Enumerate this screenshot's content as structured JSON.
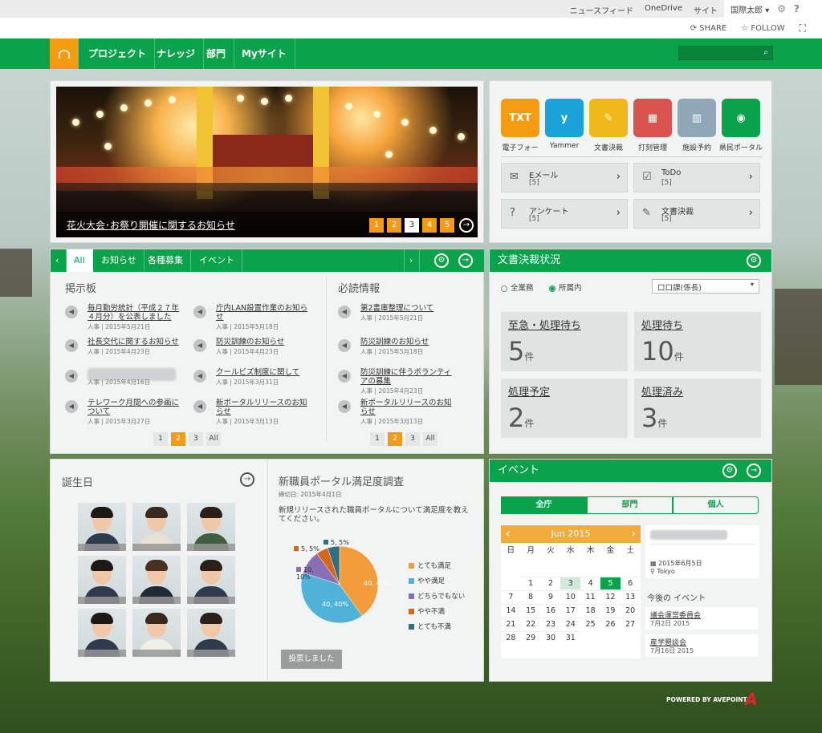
{
  "suite": {
    "links": [
      "ニュースフィード",
      "OneDrive",
      "サイト"
    ],
    "user": "国際太郎",
    "user_caret": "▾",
    "gear": "⚙",
    "help": "?"
  },
  "actions": {
    "share": "SHARE",
    "follow": "FOLLOW"
  },
  "nav": {
    "items": [
      "プロジェクト",
      "ナレッジ",
      "部門",
      "Myサイト"
    ],
    "search_icon": "⌕"
  },
  "hero": {
    "caption": "花火大会･お祭り開催に関するお知らせ",
    "pages": [
      "1",
      "2",
      "3",
      "4",
      "5"
    ],
    "current_page": "3",
    "next_icon": "→"
  },
  "apps": {
    "tiles": [
      {
        "label": "電子フォー",
        "glyph": "TXT",
        "color": "#f39c12"
      },
      {
        "label": "Yammer",
        "glyph": "y",
        "color": "#1aa3d9"
      },
      {
        "label": "文書決裁",
        "glyph": "✎",
        "color": "#f1b81c"
      },
      {
        "label": "打刻管理",
        "glyph": "▦",
        "color": "#d9534f"
      },
      {
        "label": "施設予約",
        "glyph": "▥",
        "color": "#8fa8b8"
      },
      {
        "label": "県民ポータル",
        "glyph": "◉",
        "color": "#0aa24b"
      }
    ],
    "quick": [
      {
        "title": "Eメール",
        "count": "[5]",
        "icon": "✉",
        "arrow": "›"
      },
      {
        "title": "ToDo",
        "count": "[5]",
        "icon": "☑",
        "arrow": "›"
      },
      {
        "title": "アンケート",
        "count": "[5]",
        "icon": "?",
        "arrow": "›"
      },
      {
        "title": "文書決裁",
        "count": "[5]",
        "icon": "✎",
        "arrow": "›"
      }
    ]
  },
  "news": {
    "prev": "‹",
    "next": "›",
    "tabs": [
      "All",
      "お知らせ",
      "各種募集",
      "イベント"
    ],
    "board_title": "掲示板",
    "board": [
      {
        "title": "毎月勤労統計（平成２７年４月分）を公表しました",
        "meta": "人事 | 2015年5月21日"
      },
      {
        "title": "庁内LAN設置作業のお知らせ",
        "meta": "人事 | 2015年5月18日"
      },
      {
        "title": "社長交代に関するお知らせ",
        "meta": "人事 | 2015年4月23日"
      },
      {
        "title": "防災訓練のお知らせ",
        "meta": "人事 | 2015年4月23日"
      },
      {
        "title": "",
        "meta": "人事 | 2015年4月16日"
      },
      {
        "title": "クールビズ制度に関して",
        "meta": "人事 | 2015年3月31日"
      },
      {
        "title": "テレワーク月間への参画について",
        "meta": "人事 | 2015年3月27日"
      },
      {
        "title": "新ポータルリリースのお知らせ",
        "meta": "人事 | 2015年3月13日"
      }
    ],
    "board_pages": [
      "1",
      "2",
      "3",
      "All"
    ],
    "required_title": "必読情報",
    "required": [
      {
        "title": "第2書庫整理について",
        "meta": "人事 | 2015年5月21日"
      },
      {
        "title": "防災訓練のお知らせ",
        "meta": "人事 | 2015年5月18日"
      },
      {
        "title": "防災訓練に伴うボランティアの募集",
        "meta": "人事 | 2015年4月23日"
      },
      {
        "title": "新ポータルリリースのお知らせ",
        "meta": "人事 | 2015年3月13日"
      }
    ],
    "required_pages": [
      "1",
      "2",
      "3",
      "All"
    ]
  },
  "docstatus": {
    "title": "文書決裁状況",
    "radio_all": "全業務",
    "radio_dept": "所属内",
    "select": "口口課(係長)",
    "stats": [
      {
        "label": "至急・処理待ち",
        "value": "5",
        "unit": "件"
      },
      {
        "label": "処理待ち",
        "value": "10",
        "unit": "件"
      },
      {
        "label": "処理予定",
        "value": "2",
        "unit": "件"
      },
      {
        "label": "処理済み",
        "value": "3",
        "unit": "件"
      }
    ]
  },
  "birthday": {
    "title": "誕生日"
  },
  "survey": {
    "title": "新職員ポータル満足度調査",
    "deadline": "締切日: 2015年4月1日",
    "question": "新規リリースされた職員ポータルについて満足度を教えてください。",
    "button": "投票しました",
    "slice_labels": [
      "40, 40%",
      "40, 40%",
      "10, 10%",
      "5, 5%",
      "5, 5%"
    ],
    "legend": [
      {
        "name": "とても満足",
        "color": "#f39c3c"
      },
      {
        "name": "やや満足",
        "color": "#4fb3d9"
      },
      {
        "name": "どちらでもない",
        "color": "#8b6fb5"
      },
      {
        "name": "やや不満",
        "color": "#d8651a"
      },
      {
        "name": "とても不満",
        "color": "#2f6f7f"
      }
    ]
  },
  "chart_data": {
    "type": "pie",
    "series": [
      {
        "label": "とても満足",
        "value": 40
      },
      {
        "label": "やや満足",
        "value": 40
      },
      {
        "label": "どちらでもない",
        "value": 10
      },
      {
        "label": "やや不満",
        "value": 5
      },
      {
        "label": "とても不満",
        "value": 5
      }
    ]
  },
  "event": {
    "title": "イベント",
    "tabs": [
      "全庁",
      "部門",
      "個人"
    ],
    "month": "Jun 2015",
    "prev": "‹",
    "next": "›",
    "dows": [
      "日",
      "月",
      "火",
      "水",
      "木",
      "金",
      "土"
    ],
    "days": [
      "1",
      "2",
      "3",
      "4",
      "5",
      "6",
      "7",
      "8",
      "9",
      "10",
      "11",
      "12",
      "13",
      "14",
      "15",
      "16",
      "17",
      "18",
      "19",
      "20",
      "21",
      "22",
      "23",
      "24",
      "25",
      "26",
      "27",
      "28",
      "29",
      "30",
      "31"
    ],
    "detail_date": "2015年6月5日",
    "detail_place": "Tokyo",
    "upcoming_title": "今後の イベント",
    "upcoming": [
      {
        "name": "議会運営委員会",
        "date": "7月2日 2015"
      },
      {
        "name": "産学懇談会",
        "date": "7月16日 2015"
      }
    ]
  },
  "footer": {
    "powered": "POWERED BY AVEPOINT",
    "logo": "A"
  }
}
